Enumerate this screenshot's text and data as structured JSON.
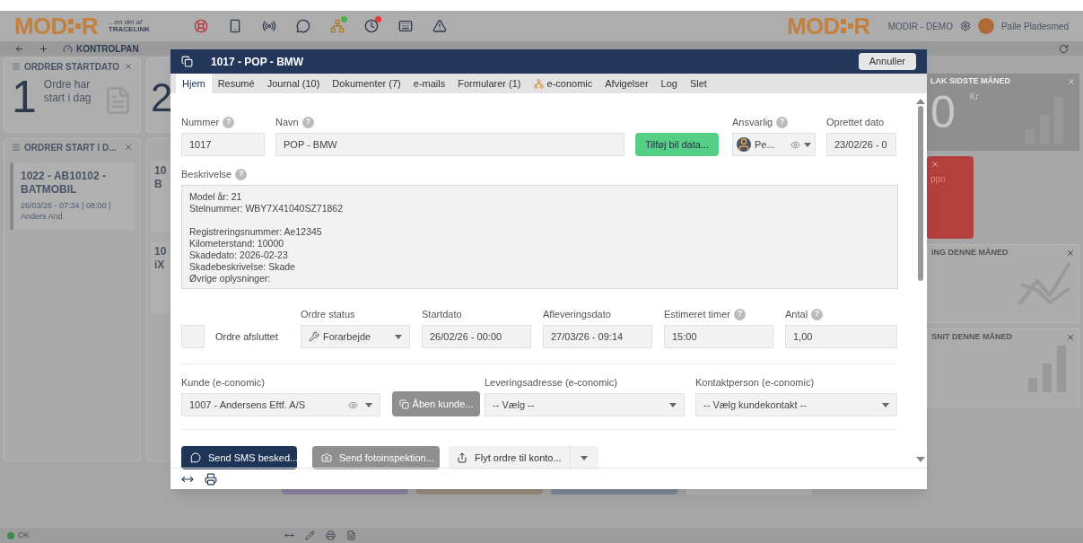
{
  "top_bar": {
    "logo": {
      "left": "MOD",
      "right": "R",
      "tagline": "...en del af",
      "partner": "TRACELINK"
    },
    "icons": [
      {
        "kind": "lifebuoy"
      },
      {
        "kind": "phone"
      },
      {
        "kind": "beacon"
      },
      {
        "kind": "chat"
      },
      {
        "kind": "network",
        "color": "#4caf50"
      },
      {
        "kind": "clock",
        "color": "#e53935"
      },
      {
        "kind": "keyboard"
      },
      {
        "kind": "warning"
      }
    ],
    "right_logo": {
      "left": "MOD",
      "right": "R"
    },
    "company": "MODIR - DEMO",
    "user": "Palle Pladesmed"
  },
  "nav": {
    "label": "KONTROLPAN"
  },
  "dashboard_left": {
    "widget": {
      "title": "ORDRER STARTDATO",
      "count": "1",
      "caption": "Ordre har start i dag"
    },
    "second_count": "2",
    "list": {
      "title": "ORDRER START I D...",
      "cards": [
        {
          "title": "1022 - AB10102 - BATMOBIL",
          "meta": "26/03/26 - 07:34 | 08:00 | Anders And"
        }
      ]
    },
    "peek_cards": [
      {
        "line_1": "10",
        "line_2": "B"
      },
      {
        "line_1": "10",
        "line_2": "iX"
      }
    ]
  },
  "dashboard_right": [
    {
      "kind": "amount",
      "title": "LAK SIDSTE MÅNED",
      "value": "0",
      "unit": "Kr"
    },
    {
      "kind": "alert",
      "text": "ppo"
    },
    {
      "kind": "trend",
      "title": "ING DENNE MÅNED"
    },
    {
      "kind": "bars",
      "title": "SNIT DENNE MÅNED"
    }
  ],
  "status_bar": {
    "status": "OK"
  },
  "modal": {
    "title": "1017 - POP - BMW",
    "cancel": "Annuller",
    "tabs": [
      {
        "label": "Hjem",
        "selected": true
      },
      {
        "label": "Resumé",
        "selected": false
      },
      {
        "label": "Journal (10)",
        "selected": false
      },
      {
        "label": "Dokumenter (7)",
        "selected": false
      },
      {
        "label": "e-mails",
        "selected": false
      },
      {
        "label": "Formularer (1)",
        "selected": false
      },
      {
        "label": "e-conomic",
        "selected": false,
        "icon": true
      },
      {
        "label": "Afvigelser",
        "selected": false
      },
      {
        "label": "Log",
        "selected": false
      },
      {
        "label": "Slet",
        "selected": false
      }
    ],
    "nummer": {
      "label": "Nummer",
      "help": "?",
      "value": "1017"
    },
    "navn": {
      "label": "Navn",
      "help": "?",
      "value": "POP - BMW"
    },
    "add_car_button": "Tilføj bil data...",
    "ansvarlig": {
      "label": "Ansvarlig",
      "help": "?",
      "value": "Pe..."
    },
    "oprettet": {
      "label": "Oprettet dato",
      "value": "23/02/26 - 0"
    },
    "beskrivelse": {
      "label": "Beskrivelse",
      "help": "?",
      "value": "Model år: 21\nStelnummer: WBY7X41040SZ71862\n\nRegistreringsnummer: Ae12345\nKilometerstand: 10000\nSkadedato: 2026-02-23\nSkadebeskrivelse: Skade\nØvrige oplysninger:"
    },
    "afsluttet": {
      "label": "Ordre afsluttet",
      "checked": false
    },
    "status": {
      "label": "Ordre status",
      "value": "Forarbejde"
    },
    "startdato": {
      "label": "Startdato",
      "value": "26/02/26 - 00:00"
    },
    "afleveringsdato": {
      "label": "Afleveringsdato",
      "value": "27/03/26 - 09:14"
    },
    "timer": {
      "label": "Estimeret timer",
      "help": "?",
      "value": "15:00"
    },
    "antal": {
      "label": "Antal",
      "help": "?",
      "value": "1,00"
    },
    "kunde": {
      "label": "Kunde (e-conomic)",
      "value": "1007 - Andersens Eftf. A/S"
    },
    "open_customer_button": "Åben kunde...",
    "levering": {
      "label": "Leveringsadresse (e-conomic)",
      "value": "-- Vælg --"
    },
    "kontakt": {
      "label": "Kontaktperson (e-conomic)",
      "value": "-- Vælg kundekontakt --"
    },
    "actions": [
      {
        "kind": "primary",
        "label": "Send SMS besked..."
      },
      {
        "kind": "muted",
        "label": "Send fotoinspektion..."
      },
      {
        "kind": "split",
        "label": "Flyt ordre til konto..."
      }
    ]
  }
}
